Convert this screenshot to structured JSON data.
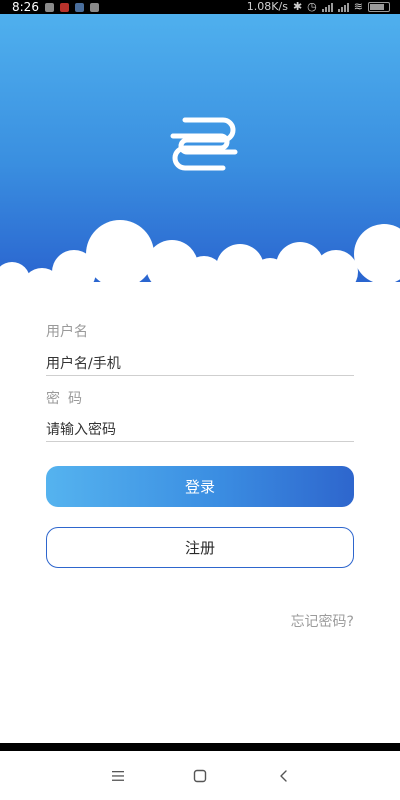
{
  "status_bar": {
    "time": "8:26",
    "network_speed": "1.08K/s"
  },
  "form": {
    "username_label": "用户名",
    "username_placeholder": "用户名/手机",
    "password_label": "密码",
    "password_placeholder": "请输入密码",
    "login_label": "登录",
    "register_label": "注册",
    "forgot_label": "忘记密码?"
  },
  "icons": {
    "logo": "app-logo-icon",
    "nav_menu": "menu-icon",
    "nav_home": "home-square-icon",
    "nav_back": "back-chevron-icon"
  },
  "colors": {
    "hero_top": "#4fb0ee",
    "hero_bottom": "#2a64cf",
    "accent": "#2e66cd",
    "label_gray": "#9a9a9a"
  }
}
